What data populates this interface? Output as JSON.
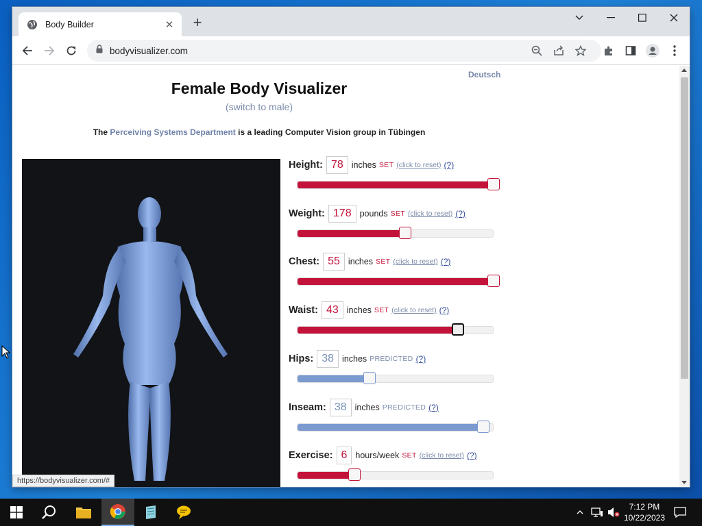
{
  "browser": {
    "tab_title": "Body Builder",
    "url": "bodyvisualizer.com",
    "status_url": "https://bodyvisualizer.com/#"
  },
  "page": {
    "language_link": "Deutsch",
    "title": "Female Body Visualizer",
    "switch_link": "(switch to male)",
    "tagline_prefix": "The ",
    "tagline_link": "Perceiving Systems Department",
    "tagline_suffix": " is a leading Computer Vision group in Tübingen"
  },
  "common": {
    "set_label": "SET",
    "predicted_label": "PREDICTED",
    "reset_label": "(click to reset)",
    "help_label": "(?)"
  },
  "measurements": [
    {
      "label": "Height:",
      "value": "78",
      "unit": "inches",
      "status": "set",
      "fraction": 1.0
    },
    {
      "label": "Weight:",
      "value": "178",
      "unit": "pounds",
      "status": "set",
      "fraction": 0.55
    },
    {
      "label": "Chest:",
      "value": "55",
      "unit": "inches",
      "status": "set",
      "fraction": 1.0
    },
    {
      "label": "Waist:",
      "value": "43",
      "unit": "inches",
      "status": "set",
      "fraction": 0.82
    },
    {
      "label": "Hips:",
      "value": "38",
      "unit": "inches",
      "status": "predicted",
      "fraction": 0.37
    },
    {
      "label": "Inseam:",
      "value": "38",
      "unit": "inches",
      "status": "predicted",
      "fraction": 0.95
    },
    {
      "label": "Exercise:",
      "value": "6",
      "unit": "hours/week",
      "status": "set",
      "fraction": 0.29
    }
  ],
  "colors": {
    "set": "#c4133a",
    "predicted": "#7b9ad0",
    "body": "#7fa3e0"
  },
  "taskbar": {
    "time": "7:12 PM",
    "date": "10/22/2023"
  }
}
